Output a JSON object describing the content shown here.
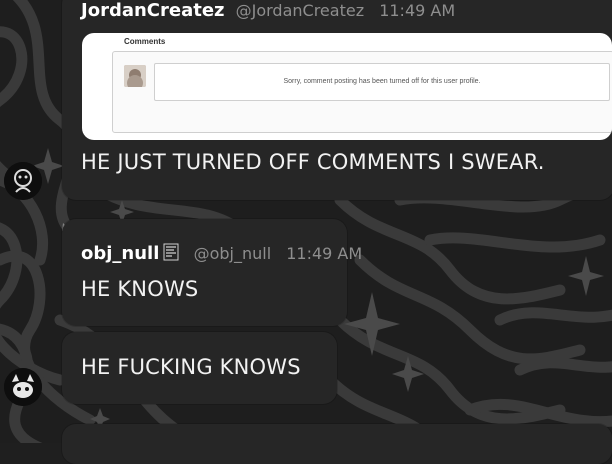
{
  "messages": [
    {
      "author": "JordanCreatez",
      "handle": "@JordanCreatez",
      "time": "11:49 AM",
      "embed": {
        "title": "Comments",
        "notice": "Sorry, comment posting has been turned off for this user profile."
      },
      "text": "HE JUST TURNED OFF COMMENTS I SWEAR."
    },
    {
      "author": "obj_null",
      "handle": "@obj_null",
      "time": "11:49 AM",
      "text": "HE KNOWS"
    },
    {
      "text": "HE FUCKING KNOWS"
    }
  ],
  "theme": {
    "background": "#1f1f1f",
    "bubble": "#262626",
    "accent_icon": "crown-icon"
  }
}
